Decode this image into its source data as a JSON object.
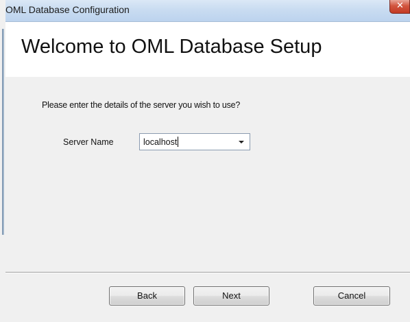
{
  "window": {
    "title": "OML Database Configuration",
    "close_glyph": "✕"
  },
  "header": {
    "heading": "Welcome to OML Database Setup"
  },
  "content": {
    "prompt": "Please enter the details of the server you wish to use?",
    "server_name_label": "Server Name",
    "server_name_value": "localhost"
  },
  "buttons": {
    "back_label": "Back",
    "next_label": "Next",
    "cancel_label": "Cancel"
  },
  "colors": {
    "titlebar": "#c9dcf1",
    "close_button": "#c23a24",
    "header_background": "#ffffff",
    "dialog_background": "#f0f0f0"
  },
  "icons": {
    "close": "close-icon",
    "dropdown": "chevron-down-icon"
  }
}
